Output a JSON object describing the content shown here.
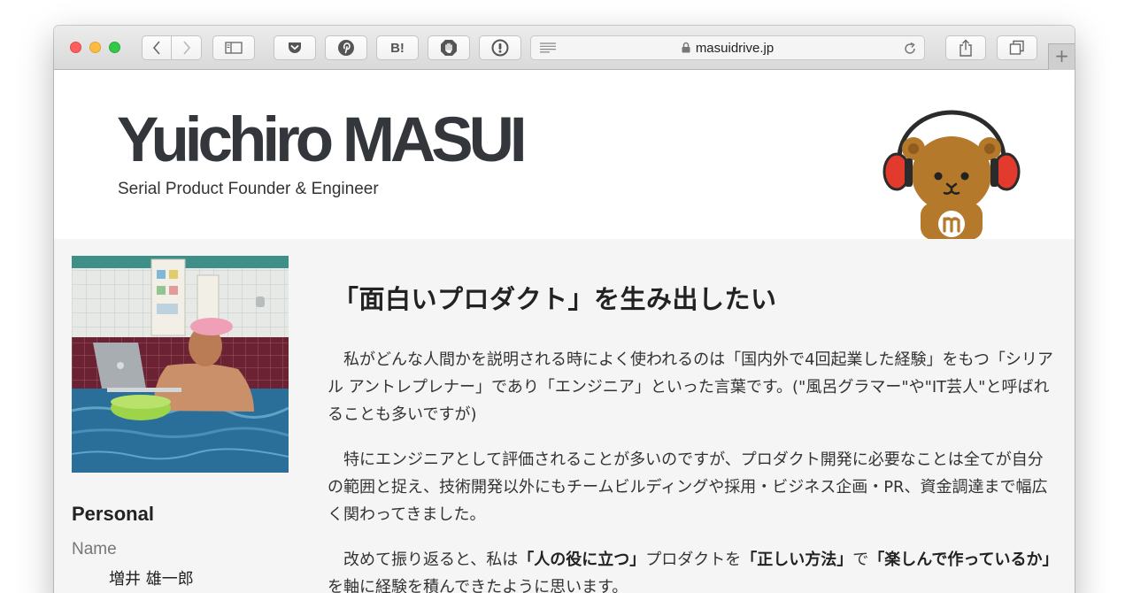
{
  "browser": {
    "url": "masuidrive.jp",
    "new_tab_label": "+",
    "hatena_label": "B!"
  },
  "site": {
    "title": "Yuichiro MASUI",
    "tagline": "Serial Product Founder & Engineer"
  },
  "sidebar": {
    "heading": "Personal",
    "name_label": "Name",
    "name_value": "増井 雄一郎"
  },
  "article": {
    "heading": "「面白いプロダクト」を生み出したい",
    "p1": "私がどんな人間かを説明される時によく使われるのは「国内外で4回起業した経験」をもつ「シリアル アントレプレナー」であり「エンジニア」といった言葉です。(\"風呂グラマー\"や\"IT芸人\"と呼ばれることも多いですが)",
    "p2": "特にエンジニアとして評価されることが多いのですが、プロダクト開発に必要なことは全てが自分の範囲と捉え、技術開発以外にもチームビルディングや採用・ビジネス企画・PR、資金調達まで幅広く関わってきました。",
    "p3_a": "改めて振り返ると、私は",
    "p3_b": "「人の役に立つ」",
    "p3_c": "プロダクトを",
    "p3_d": "「正しい方法」",
    "p3_e": "で",
    "p3_f": "「楽しんで作っているか」",
    "p3_g": "を軸に経験を積んできたように思います。"
  },
  "colors": {
    "title": "#33363b",
    "mascot_brown": "#b5792c",
    "headphone_red": "#e23a2c"
  }
}
